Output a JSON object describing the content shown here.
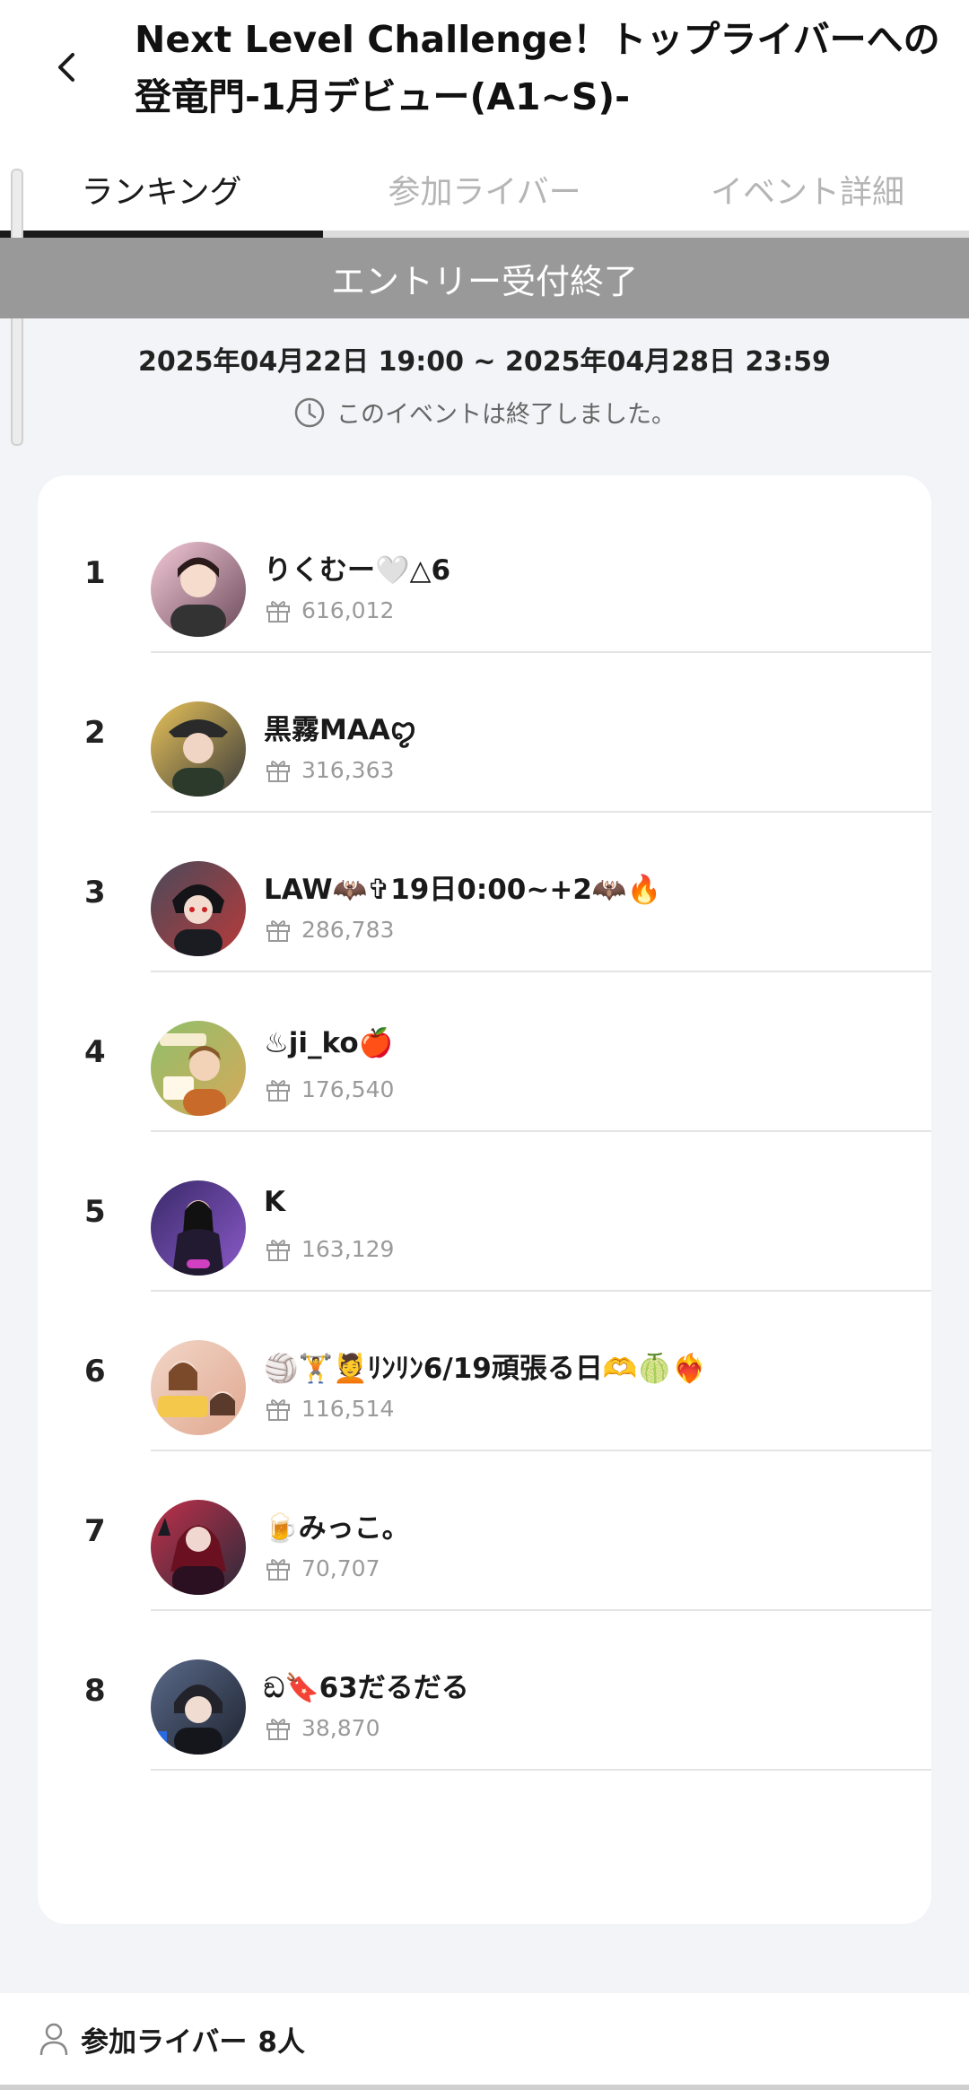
{
  "header": {
    "title": "Next Level Challenge！トップライバーへの登竜門-1月デビュー(A1~S)-"
  },
  "tabs": [
    {
      "label": "ランキング",
      "active": true
    },
    {
      "label": "参加ライバー",
      "active": false
    },
    {
      "label": "イベント詳細",
      "active": false
    }
  ],
  "banner": {
    "text": "エントリー受付終了",
    "color": "#999999"
  },
  "event": {
    "date_range": "2025年04月22日 19:00 ~ 2025年04月28日 23:59",
    "status": "このイベントは終了しました。"
  },
  "ranking": [
    {
      "rank": "1",
      "name": "りくむー🤍△6",
      "score": "616,012",
      "avatar_colors": [
        "#f3c9d7",
        "#6b4a5a"
      ]
    },
    {
      "rank": "2",
      "name": "黒霧MAAꨄ",
      "score": "316,363",
      "avatar_colors": [
        "#e8c35a",
        "#3b3b3b"
      ]
    },
    {
      "rank": "3",
      "name": "LAW🦇✞19日0:00~+2🦇🔥",
      "score": "286,783",
      "avatar_colors": [
        "#4a4a5a",
        "#b83a3a"
      ]
    },
    {
      "rank": "4",
      "name": "♨ji_ko🍎",
      "score": "176,540",
      "avatar_colors": [
        "#8fbf6a",
        "#d6a95a"
      ]
    },
    {
      "rank": "5",
      "name": "K",
      "score": "163,129",
      "avatar_colors": [
        "#3a2a6a",
        "#8a5ac8"
      ]
    },
    {
      "rank": "6",
      "name": "🏐🏋💆ﾘﾝﾘﾝ6/19頑張る日🫶🍈❤‍🔥",
      "score": "116,514",
      "avatar_colors": [
        "#f2d6c8",
        "#e0a890"
      ]
    },
    {
      "rank": "7",
      "name": "🍺みっこ。",
      "score": "70,707",
      "avatar_colors": [
        "#c0304a",
        "#2a2a3a"
      ]
    },
    {
      "rank": "8",
      "name": "ඞ🔖63だるだる",
      "score": "38,870",
      "avatar_colors": [
        "#5a6a8a",
        "#1f2430"
      ]
    }
  ],
  "footer": {
    "label": "参加ライバー",
    "count": "8人"
  },
  "icons": {
    "back": "chevron-left-icon",
    "clock": "clock-icon",
    "gift": "gift-icon",
    "person": "person-icon"
  }
}
